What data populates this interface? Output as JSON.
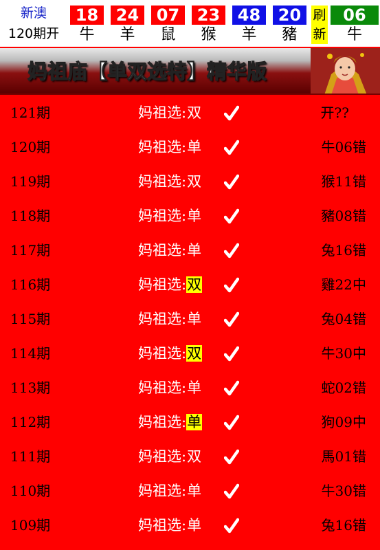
{
  "header": {
    "brand_line1": "新澳",
    "brand_line2": "120期开",
    "balls": [
      {
        "num": "18",
        "zodiac": "牛",
        "color": "red"
      },
      {
        "num": "24",
        "zodiac": "羊",
        "color": "red"
      },
      {
        "num": "07",
        "zodiac": "鼠",
        "color": "red"
      },
      {
        "num": "23",
        "zodiac": "猴",
        "color": "red"
      },
      {
        "num": "48",
        "zodiac": "羊",
        "color": "blue"
      },
      {
        "num": "20",
        "zodiac": "豬",
        "color": "blue"
      }
    ],
    "refresh_chars": [
      "刷",
      "新"
    ],
    "special": {
      "num": "06",
      "zodiac": "牛",
      "color": "green"
    }
  },
  "banner": {
    "title": "妈祖庙【单双选特】精华版",
    "portrait_icon": "goddess-portrait-icon"
  },
  "rows": [
    {
      "period": "121期",
      "label": "妈祖选:",
      "pick": "双",
      "highlight": false,
      "result": "开??"
    },
    {
      "period": "120期",
      "label": "妈祖选:",
      "pick": "单",
      "highlight": false,
      "result": "牛06错"
    },
    {
      "period": "119期",
      "label": "妈祖选:",
      "pick": "双",
      "highlight": false,
      "result": "猴11错"
    },
    {
      "period": "118期",
      "label": "妈祖选:",
      "pick": "单",
      "highlight": false,
      "result": "豬08错"
    },
    {
      "period": "117期",
      "label": "妈祖选:",
      "pick": "单",
      "highlight": false,
      "result": "兔16错"
    },
    {
      "period": "116期",
      "label": "妈祖选:",
      "pick": "双",
      "highlight": true,
      "result": "雞22中"
    },
    {
      "period": "115期",
      "label": "妈祖选:",
      "pick": "单",
      "highlight": false,
      "result": "兔04错"
    },
    {
      "period": "114期",
      "label": "妈祖选:",
      "pick": "双",
      "highlight": true,
      "result": "牛30中"
    },
    {
      "period": "113期",
      "label": "妈祖选:",
      "pick": "单",
      "highlight": false,
      "result": "蛇02错"
    },
    {
      "period": "112期",
      "label": "妈祖选:",
      "pick": "单",
      "highlight": true,
      "result": "狗09中"
    },
    {
      "period": "111期",
      "label": "妈祖选:",
      "pick": "双",
      "highlight": false,
      "result": "馬01错"
    },
    {
      "period": "110期",
      "label": "妈祖选:",
      "pick": "单",
      "highlight": false,
      "result": "牛30错"
    },
    {
      "period": "109期",
      "label": "妈祖选:",
      "pick": "单",
      "highlight": false,
      "result": "兔16错"
    }
  ],
  "colors": {
    "page_bg": "#ff0000",
    "ball_red": "#ff0000",
    "ball_blue": "#1010e6",
    "ball_green": "#0a8a0a",
    "highlight": "#ffff00",
    "brand_text": "#1a27c9"
  },
  "icons": {
    "check": "checkmark-icon"
  }
}
